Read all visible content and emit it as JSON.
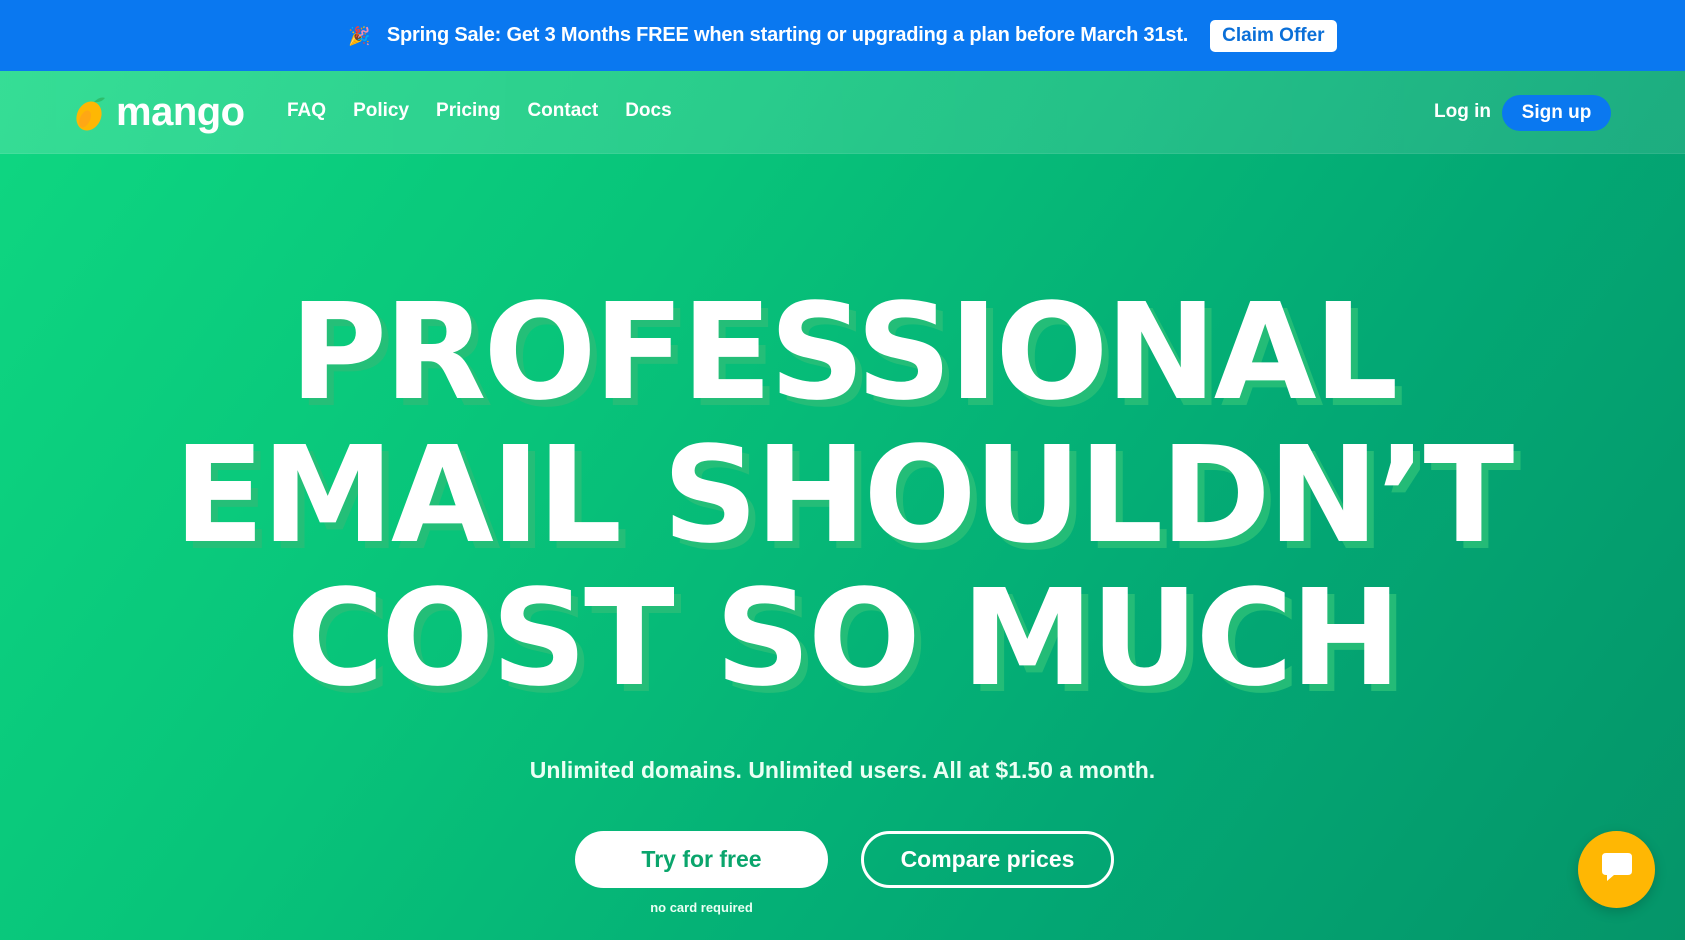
{
  "promo": {
    "icon": "party-popper-icon",
    "text": "Spring Sale: Get 3 Months FREE when starting or upgrading a plan before March 31st.",
    "button": "Claim Offer"
  },
  "nav": {
    "logo_text": "mango",
    "links": [
      "FAQ",
      "Policy",
      "Pricing",
      "Contact",
      "Docs"
    ],
    "login": "Log in",
    "signup": "Sign up"
  },
  "hero": {
    "title_lines": [
      "PROFESSIONAL",
      "EMAIL SHOULDN’T",
      "COST SO MUCH"
    ],
    "subtitle": "Unlimited domains. Unlimited users. All at $1.50 a month.",
    "primary_button": "Try for free",
    "secondary_button": "Compare prices",
    "note": "no card required"
  },
  "chat": {
    "icon": "chat-bubble-icon"
  },
  "colors": {
    "promo_bg": "#0a78f0",
    "accent_green": "#0aa56c",
    "chat_yellow": "#ffb703"
  }
}
